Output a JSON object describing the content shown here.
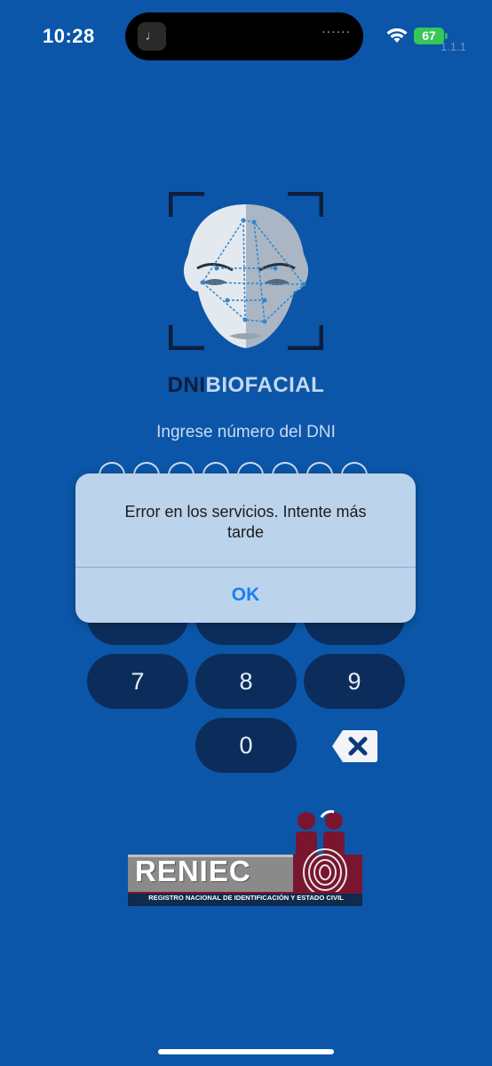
{
  "status_bar": {
    "time": "10:28",
    "island_app_glyph": "♩",
    "island_dots": "······",
    "battery": "67",
    "version": "1.1.1"
  },
  "logo": {
    "word_dni": "DNI",
    "word_biofacial": "BIOFACIAL"
  },
  "prompt": "Ingrese número del DNI",
  "pin_dot_count": 8,
  "keypad": {
    "keys_visible": [
      "7",
      "8",
      "9",
      "0"
    ],
    "delete_icon": "backspace-x-icon"
  },
  "reniec": {
    "name": "RENIEC",
    "subtitle": "REGISTRO NACIONAL DE IDENTIFICACIÓN Y ESTADO CIVIL"
  },
  "alert": {
    "message": "Error en los servicios. Intente más tarde",
    "ok_label": "OK"
  },
  "colors": {
    "background": "#0b56a8",
    "key": "#0c2d5c",
    "alert": "#bcd3ec",
    "accent": "#1a7ff0"
  }
}
